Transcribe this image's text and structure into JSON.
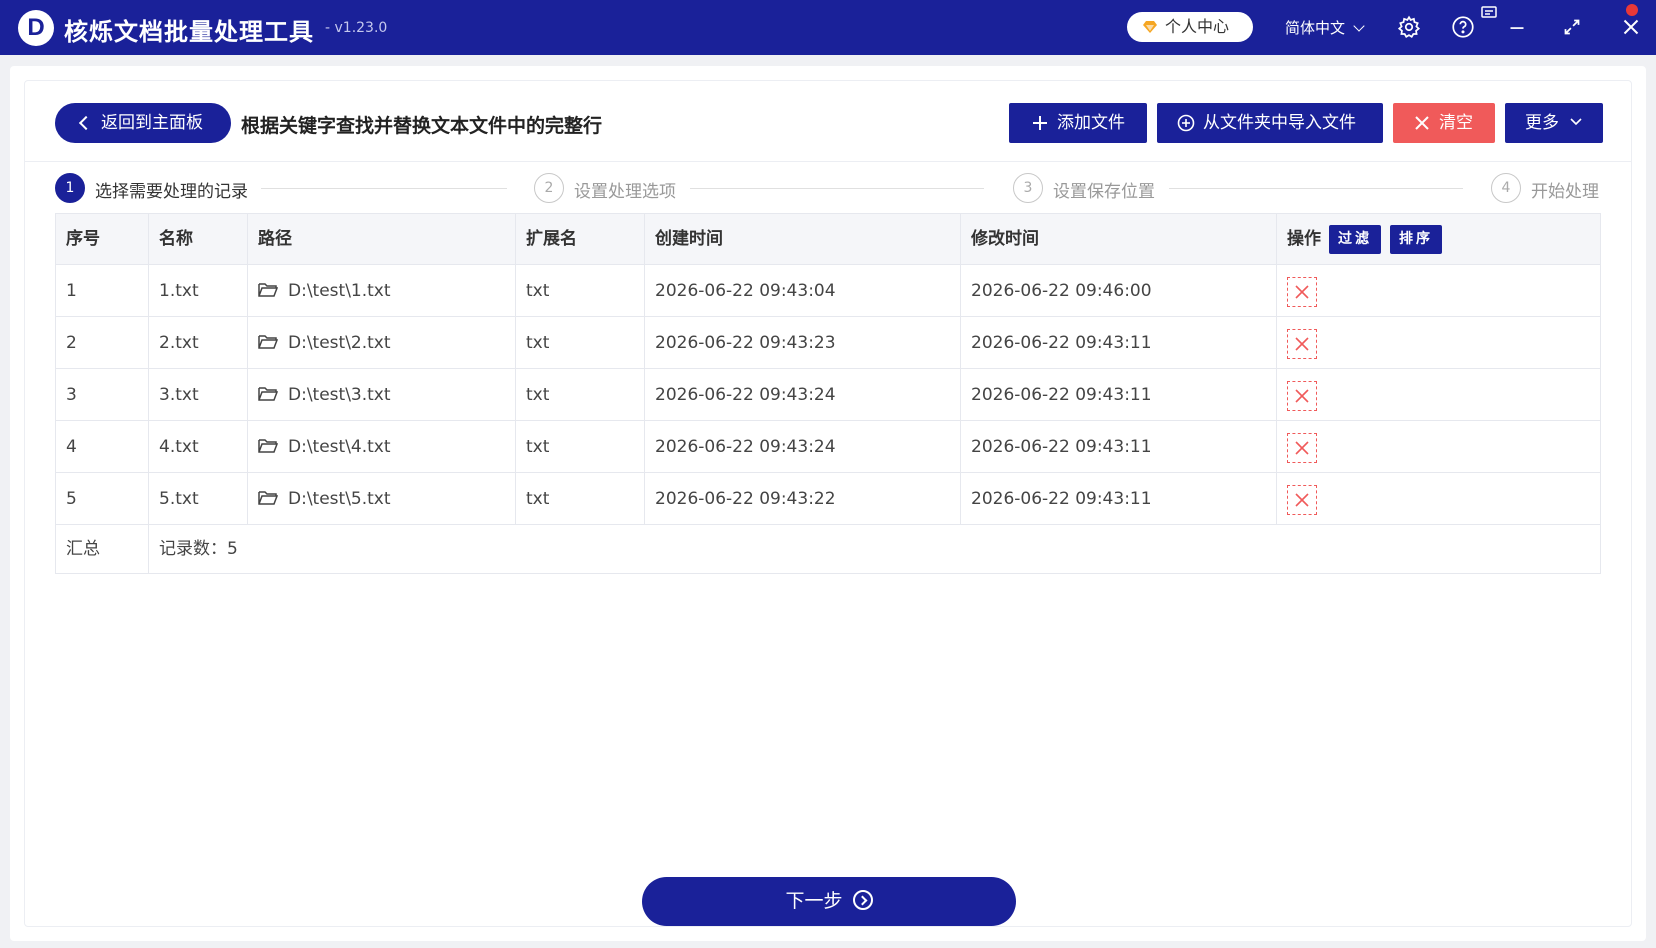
{
  "app": {
    "logo_letter": "D",
    "title": "核烁文档批量处理工具",
    "version": "- v1.23.0"
  },
  "titlebar": {
    "personal_center": "个人中心",
    "language": "简体中文",
    "icons": [
      "diamond-icon",
      "chevron-down-icon",
      "gear-icon",
      "help-icon",
      "feedback-icon",
      "minimize-icon",
      "maximize-icon",
      "close-icon"
    ]
  },
  "toolbar": {
    "back_label": "返回到主面板",
    "page_title": "根据关键字查找并替换文本文件中的完整行",
    "add_file": "添加文件",
    "import_folder": "从文件夹中导入文件",
    "clear": "清空",
    "more": "更多"
  },
  "steps": [
    {
      "num": "1",
      "label": "选择需要处理的记录",
      "active": true
    },
    {
      "num": "2",
      "label": "设置处理选项",
      "active": false
    },
    {
      "num": "3",
      "label": "设置保存位置",
      "active": false
    },
    {
      "num": "4",
      "label": "开始处理",
      "active": false
    }
  ],
  "table": {
    "headers": [
      "序号",
      "名称",
      "路径",
      "扩展名",
      "创建时间",
      "修改时间",
      "操作"
    ],
    "filter_label": "过滤",
    "sort_label": "排序",
    "rows": [
      {
        "idx": "1",
        "name": "1.txt",
        "path": "D:\\test\\1.txt",
        "ext": "txt",
        "created": "2026-06-22 09:43:04",
        "modified": "2026-06-22 09:46:00"
      },
      {
        "idx": "2",
        "name": "2.txt",
        "path": "D:\\test\\2.txt",
        "ext": "txt",
        "created": "2026-06-22 09:43:23",
        "modified": "2026-06-22 09:43:11"
      },
      {
        "idx": "3",
        "name": "3.txt",
        "path": "D:\\test\\3.txt",
        "ext": "txt",
        "created": "2026-06-22 09:43:24",
        "modified": "2026-06-22 09:43:11"
      },
      {
        "idx": "4",
        "name": "4.txt",
        "path": "D:\\test\\4.txt",
        "ext": "txt",
        "created": "2026-06-22 09:43:24",
        "modified": "2026-06-22 09:43:11"
      },
      {
        "idx": "5",
        "name": "5.txt",
        "path": "D:\\test\\5.txt",
        "ext": "txt",
        "created": "2026-06-22 09:43:22",
        "modified": "2026-06-22 09:43:11"
      }
    ],
    "summary_label": "汇总",
    "summary_value": "记录数：5"
  },
  "footer": {
    "next_label": "下一步"
  },
  "colors": {
    "primary": "#1a2199",
    "danger": "#f05a5a"
  }
}
